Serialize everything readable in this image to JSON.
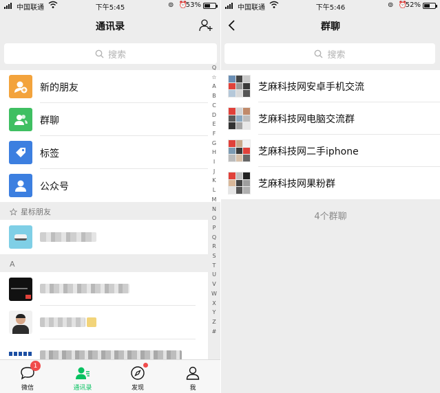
{
  "left": {
    "status": {
      "carrier": "中国联通",
      "time": "下午5:45",
      "sys_icons": "⊚ ⏰",
      "battery": "53%",
      "battery_level": 0.53
    },
    "nav": {
      "title": "通讯录",
      "add_icon": "add-friend-icon"
    },
    "search": {
      "placeholder": "搜索"
    },
    "menu": [
      {
        "label": "新的朋友",
        "color": "#f3a33c",
        "icon": "new-friends-icon"
      },
      {
        "label": "群聊",
        "color": "#3fbf62",
        "icon": "group-chat-icon"
      },
      {
        "label": "标签",
        "color": "#3c7fe0",
        "icon": "tag-icon"
      },
      {
        "label": "公众号",
        "color": "#3c7fe0",
        "icon": "official-account-icon"
      }
    ],
    "starred_header": "星标朋友",
    "section_a": "A",
    "index_letters": [
      "Q",
      "☆",
      "A",
      "B",
      "C",
      "D",
      "E",
      "F",
      "G",
      "H",
      "I",
      "J",
      "K",
      "L",
      "M",
      "N",
      "O",
      "P",
      "Q",
      "R",
      "S",
      "T",
      "U",
      "V",
      "W",
      "X",
      "Y",
      "Z",
      "#"
    ],
    "tabs": [
      {
        "label": "微信",
        "icon": "chat-bubble-icon",
        "badge": "1"
      },
      {
        "label": "通讯录",
        "icon": "contacts-icon",
        "active": true
      },
      {
        "label": "发现",
        "icon": "compass-icon",
        "dot": true
      },
      {
        "label": "我",
        "icon": "person-icon"
      }
    ],
    "accent": "#07c160"
  },
  "right": {
    "status": {
      "carrier": "中国联通",
      "time": "下午5:46",
      "sys_icons": "⊚ ⏰",
      "battery": "52%",
      "battery_level": 0.52
    },
    "nav": {
      "title": "群聊",
      "back_icon": "back-arrow-icon"
    },
    "search": {
      "placeholder": "搜索"
    },
    "groups": [
      {
        "name": "芝麻科技网安卓手机交流"
      },
      {
        "name": "芝麻科技网电脑交流群"
      },
      {
        "name": "芝麻科技网二手iphone"
      },
      {
        "name": "芝麻科技网果粉群"
      }
    ],
    "count_label": "4个群聊"
  }
}
